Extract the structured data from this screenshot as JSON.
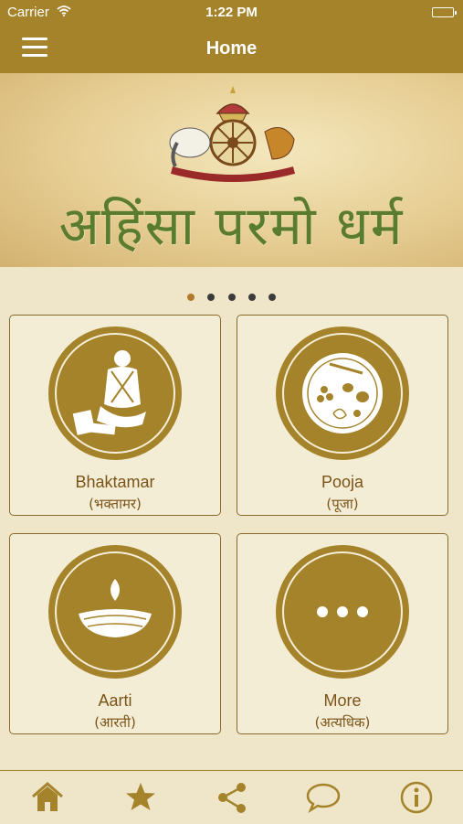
{
  "status_bar": {
    "carrier": "Carrier",
    "time": "1:22 PM"
  },
  "nav": {
    "title": "Home"
  },
  "banner": {
    "motto": "अहिंसा परमो धर्म"
  },
  "pager": {
    "pages": 5,
    "current": 1
  },
  "tiles": [
    {
      "label": "Bhaktamar",
      "sub": "(भक्तामर)",
      "icon": "meditating-figure-icon"
    },
    {
      "label": "Pooja",
      "sub": "(पूजा)",
      "icon": "pooja-thali-icon"
    },
    {
      "label": "Aarti",
      "sub": "(आरती)",
      "icon": "diya-lamp-icon"
    },
    {
      "label": "More",
      "sub": "(अत्यधिक)",
      "icon": "more-dots-icon"
    }
  ],
  "tab_bar": {
    "items": [
      "home-icon",
      "star-icon",
      "share-icon",
      "chat-icon",
      "info-icon"
    ]
  },
  "colors": {
    "accent": "#a5832a",
    "background": "#efe6c9",
    "text": "#7a5318"
  }
}
